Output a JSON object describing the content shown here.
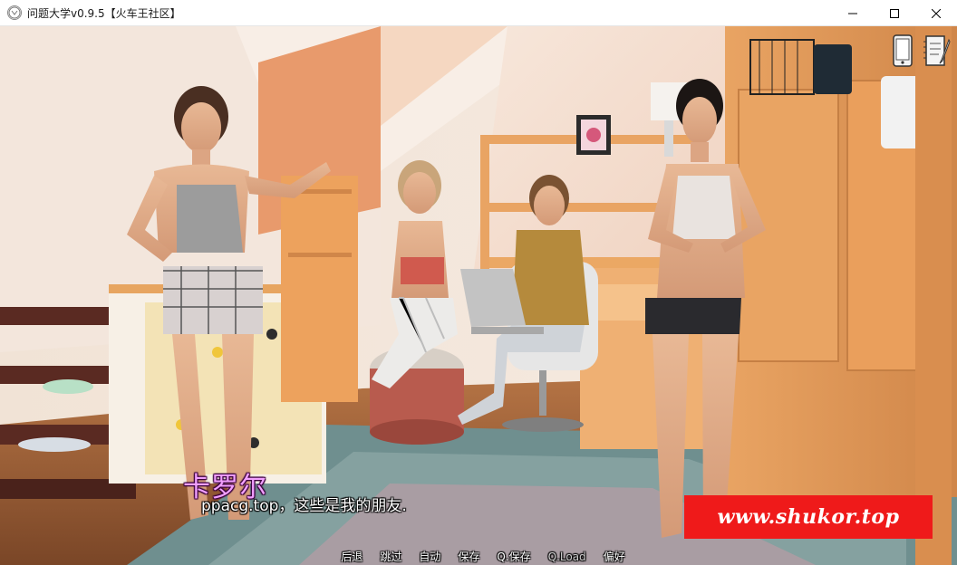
{
  "window": {
    "title": "问题大学v0.9.5【火车王社区】",
    "icon_name": "app-logo-icon",
    "controls": [
      "minimize-icon",
      "maximize-icon",
      "close-icon"
    ]
  },
  "hud": {
    "icons": [
      "phone-icon",
      "notebook-icon"
    ]
  },
  "dialogue": {
    "speaker": "卡罗尔",
    "speaker_color": "#f2a0ff",
    "text": "ppacg.top，这些是我的朋友."
  },
  "watermark": {
    "text": "www.shukor.top",
    "background": "#ef1a1a"
  },
  "quick_menu": {
    "items": [
      {
        "label": "后退",
        "enabled": true
      },
      {
        "label": "跳过",
        "enabled": true
      },
      {
        "label": "自动",
        "enabled": true
      },
      {
        "label": "保存",
        "enabled": true
      },
      {
        "label": "Q.保存",
        "enabled": true
      },
      {
        "label": "Q.Load",
        "enabled": false
      },
      {
        "label": "偏好",
        "enabled": true
      }
    ]
  }
}
